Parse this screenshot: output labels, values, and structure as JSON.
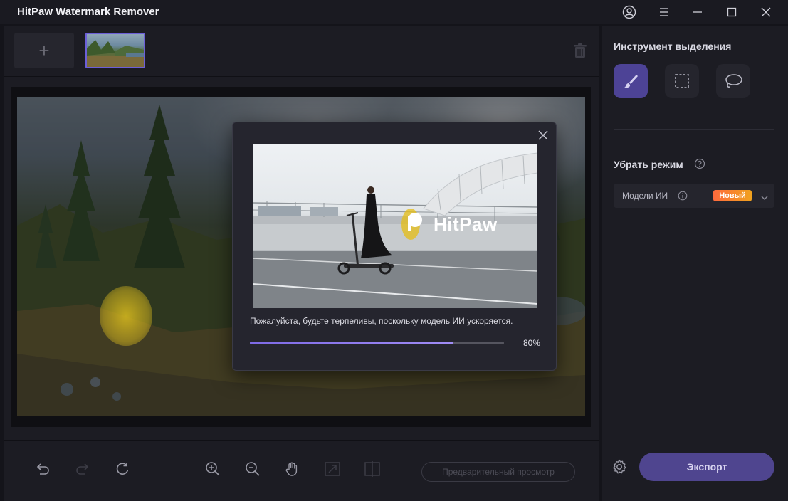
{
  "window": {
    "title": "HitPaw Watermark Remover",
    "controls": [
      "account-icon",
      "menu-icon",
      "minimize-icon",
      "maximize-icon",
      "close-icon"
    ]
  },
  "thumbnails": {
    "add_label": "+",
    "items": [
      {
        "selected": true
      }
    ]
  },
  "right_panel": {
    "selection_tool_title": "Инструмент выделения",
    "tools": [
      "brush-icon",
      "rectangle-select-icon",
      "lasso-icon"
    ],
    "active_tool": "brush-icon",
    "remove_mode_title": "Убрать режим",
    "mode_value": "Модели ИИ",
    "new_badge": "Новый",
    "export_label": "Экспорт"
  },
  "bottom_toolbar": {
    "icons": [
      "undo-icon",
      "redo-icon",
      "reset-icon",
      "zoom-in-icon",
      "zoom-out-icon",
      "pan-hand-icon",
      "fit-icon",
      "compare-icon"
    ],
    "preview_label": "Предварительный просмотр"
  },
  "modal": {
    "watermark_text": "HitPaw",
    "message": "Пожалуйста, будьте терпеливы, поскольку модель ИИ ускоряется.",
    "progress": 80,
    "progress_text": "80%"
  },
  "colors": {
    "accent": "#6c5fd8",
    "badge_from": "#ff6a3d",
    "badge_to": "#f0a21e",
    "export_bg": "#4f458f"
  }
}
